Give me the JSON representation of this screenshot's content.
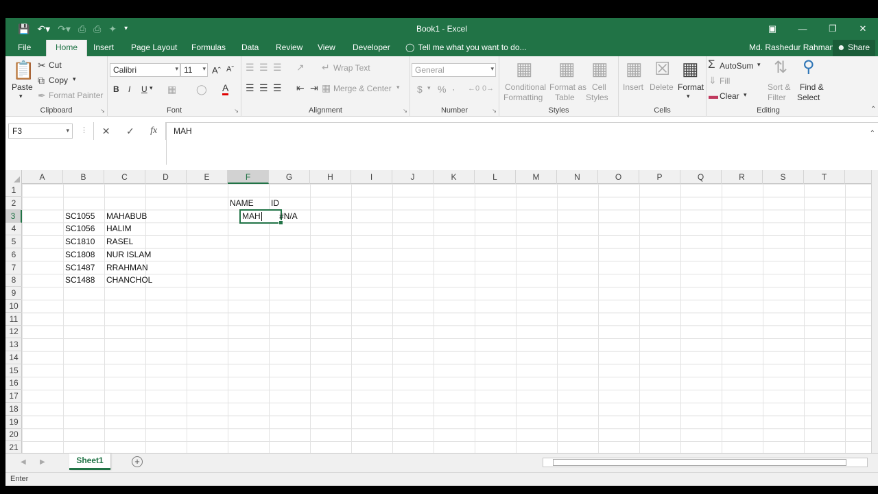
{
  "window": {
    "title": "Book1 - Excel"
  },
  "tabs": [
    "File",
    "Home",
    "Insert",
    "Page Layout",
    "Formulas",
    "Data",
    "Review",
    "View",
    "Developer"
  ],
  "active_tab": "Home",
  "tellme": "Tell me what you want to do...",
  "user": "Md. Rashedur Rahman",
  "share": "Share",
  "ribbon": {
    "clipboard": {
      "label": "Clipboard",
      "paste": "Paste",
      "cut": "Cut",
      "copy": "Copy",
      "format_painter": "Format Painter"
    },
    "font": {
      "label": "Font",
      "name": "Calibri",
      "size": "11",
      "bold": "B",
      "italic": "I",
      "underline": "U"
    },
    "alignment": {
      "label": "Alignment",
      "wrap_text": "Wrap Text",
      "merge_center": "Merge & Center"
    },
    "number": {
      "label": "Number",
      "format": "General",
      "currency": "$",
      "percent": "%"
    },
    "styles": {
      "label": "Styles",
      "conditional": "Conditional",
      "formatting": "Formatting",
      "format_as": "Format as",
      "table": "Table",
      "cell": "Cell",
      "cell_styles": "Styles"
    },
    "cells": {
      "label": "Cells",
      "insert": "Insert",
      "delete": "Delete",
      "format": "Format"
    },
    "editing": {
      "label": "Editing",
      "autosum": "AutoSum",
      "fill": "Fill",
      "clear": "Clear",
      "sort": "Sort &",
      "filter": "Filter",
      "find": "Find &",
      "select": "Select"
    }
  },
  "formula_bar": {
    "name_box": "F3",
    "content": "MAH",
    "fx": "fx"
  },
  "columns": [
    "A",
    "B",
    "C",
    "D",
    "E",
    "F",
    "G",
    "H",
    "I",
    "J",
    "K",
    "L",
    "M",
    "N",
    "O",
    "P",
    "Q",
    "R",
    "S",
    "T"
  ],
  "selected_column": "F",
  "rows": [
    "1",
    "2",
    "3",
    "4",
    "5",
    "6",
    "7",
    "8",
    "9",
    "10",
    "11",
    "12",
    "13",
    "14",
    "15",
    "16",
    "17",
    "18",
    "19",
    "20",
    "21"
  ],
  "selected_row": "3",
  "cells": {
    "F2": "NAME",
    "G2": "ID",
    "B3": "SC1055",
    "C3": "MAHABUB",
    "G3": "#N/A",
    "B4": "SC1056",
    "C4": "HALIM",
    "B5": "SC1810",
    "C5": "RASEL",
    "B6": "SC1808",
    "C6": "NUR ISLAM",
    "B7": "SC1487",
    "C7": "RRAHMAN",
    "B8": "SC1488",
    "C8": "CHANCHOL"
  },
  "active_cell": {
    "ref": "F3",
    "value": "MAH"
  },
  "sheet_tab": "Sheet1",
  "status": "Enter",
  "colors": {
    "accent": "#217346"
  }
}
